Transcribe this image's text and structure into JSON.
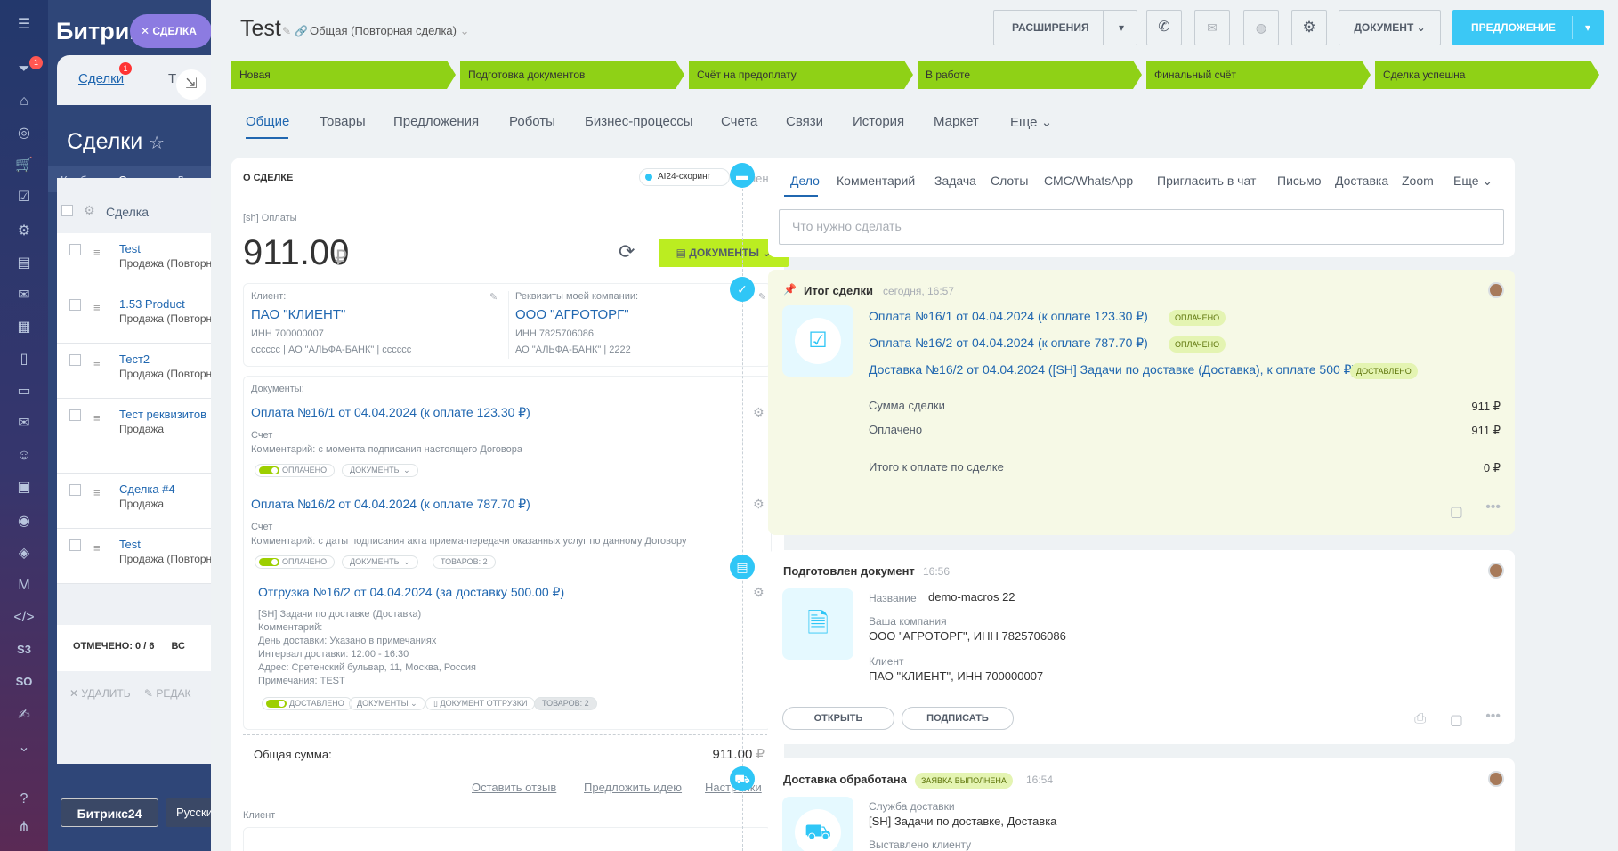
{
  "background": {
    "logo": "Битрикс",
    "deal_chip": "СДЕЛКА",
    "tab_deals": "Сделки",
    "tab_deals_badge": "1",
    "tab_second": "Т",
    "title": "Сделки",
    "view_kanban": "Канбан",
    "view_list": "Список",
    "view_more": "Де",
    "column_deal": "Сделка",
    "rows": [
      {
        "title": "Test",
        "subtitle": "Продажа (Повторн"
      },
      {
        "title": "1.53 Product",
        "subtitle": "Продажа (Повторн"
      },
      {
        "title": "Тест2",
        "subtitle": "Продажа (Повторн"
      },
      {
        "title": "Тест реквизитов",
        "subtitle": "Продажа"
      },
      {
        "title": "Сделка #4",
        "subtitle": "Продажа"
      },
      {
        "title": "Test",
        "subtitle": "Продажа (Повторн"
      }
    ],
    "marked": "ОТМЕЧЕНО: 0 / 6",
    "marked_suffix": "ВС",
    "delete": "УДАЛИТЬ",
    "edit": "РЕДАК",
    "bitrix24_btn": "Битрикс24",
    "lang_btn": "Русски",
    "rail_badge": "1",
    "rail_labels": [
      "S3",
      "SO"
    ]
  },
  "header": {
    "title": "Test",
    "category": "Общая (Повторная сделка)",
    "btn_extensions": "РАСШИРЕНИЯ",
    "btn_document": "ДОКУМЕНТ",
    "btn_offer": "ПРЕДЛОЖЕНИЕ"
  },
  "stages": [
    "Новая",
    "Подготовка документов",
    "Счёт на предоплату",
    "В работе",
    "Финальный счёт",
    "Сделка успешна"
  ],
  "stage_color": "#8fd116",
  "tabs": [
    "Общие",
    "Товары",
    "Предложения",
    "Роботы",
    "Бизнес-процессы",
    "Счета",
    "Связи",
    "История",
    "Маркет",
    "Еще"
  ],
  "about": {
    "title": "О СДЕЛКЕ",
    "ai_chip": "AI24-скоринг",
    "edit": "изменить",
    "payments_label": "[sh] Оплаты",
    "sum": "911.00",
    "currency": "₽",
    "docs_btn": "ДОКУМЕНТЫ",
    "client_label": "Клиент:",
    "client_name": "ПАО \"КЛИЕНТ\"",
    "client_inn": "ИНН 700000007",
    "client_bank": "сссссс | АО \"АЛЬФА-БАНК\" | сссссс",
    "company_label": "Реквизиты моей компании:",
    "company_name": "ООО \"АГРОТОРГ\"",
    "company_inn": "ИНН 7825706086",
    "company_bank": "АО \"АЛЬФА-БАНК\" | 2222",
    "documents_label": "Документы:",
    "doc1_title": "Оплата №16/1 от 04.04.2024 (к оплате 123.30 ₽)",
    "doc1_type": "Счет",
    "doc1_comment": "Комментарий: с момента подписания настоящего Договора",
    "doc2_title": "Оплата №16/2 от 04.04.2024 (к оплате 787.70 ₽)",
    "doc2_type": "Счет",
    "doc2_comment": "Комментарий: с даты подписания акта приема-передачи оказанных услуг по данному Договору",
    "paid": "ОПЛАЧЕНО",
    "documents_badge": "ДОКУМЕНТЫ",
    "goods2": "ТОВАРОВ: 2",
    "ship_title": "Отгрузка №16/2 от 04.04.2024 (за доставку 500.00 ₽)",
    "ship_service": "[SH] Задачи по доставке (Доставка)",
    "ship_comment": "Комментарий:",
    "ship_day": "День доставки: Указано в примечаниях",
    "ship_interval": "Интервал доставки: 12:00 - 16:30",
    "ship_address": "Адрес: Сретенский бульвар, 11, Москва, Россия",
    "ship_notes": "Примечания: TEST",
    "delivered": "ДОСТАВЛЕНО",
    "ship_doc": "ДОКУМЕНТ ОТГРУЗКИ",
    "total_label": "Общая сумма:",
    "total_value": "911.00",
    "link_review": "Оставить отзыв",
    "link_idea": "Предложить идею",
    "link_settings": "Настройки",
    "client_section": "Клиент"
  },
  "editor": {
    "tabs": [
      "Дело",
      "Комментарий",
      "Задача",
      "Слоты",
      "СМС/WhatsApp",
      "Пригласить в чат",
      "Письмо",
      "Доставка",
      "Zoom",
      "Еще"
    ],
    "placeholder": "Что нужно сделать"
  },
  "summary": {
    "title": "Итог сделки",
    "time": "сегодня, 16:57",
    "pay1": "Оплата №16/1 от 04.04.2024 (к оплате 123.30 ₽)",
    "pay2": "Оплата №16/2 от 04.04.2024 (к оплате 787.70 ₽)",
    "delivery": "Доставка №16/2 от 04.04.2024 ([SH] Задачи по доставке (Доставка), к оплате 500 ₽)",
    "badge_paid": "ОПЛАЧЕНО",
    "badge_delivered": "ДОСТАВЛЕНО",
    "deal_sum_label": "Сумма сделки",
    "deal_sum": "911 ₽",
    "paid_label": "Оплачено",
    "paid": "911 ₽",
    "due_label": "Итого к оплате по сделке",
    "due": "0 ₽"
  },
  "doc_card": {
    "title": "Подготовлен документ",
    "time": "16:56",
    "name_label": "Название",
    "name": "demo-macros 22",
    "company_label": "Ваша компания",
    "company": "ООО \"АГРОТОРГ\", ИНН 7825706086",
    "client_label": "Клиент",
    "client": "ПАО \"КЛИЕНТ\", ИНН 700000007",
    "open": "ОТКРЫТЬ",
    "sign": "ПОДПИСАТЬ"
  },
  "delivery_card": {
    "title": "Доставка обработана",
    "badge": "ЗАЯВКА ВЫПОЛНЕНА",
    "time": "16:54",
    "service_label": "Служба доставки",
    "service": "[SH] Задачи по доставке, Доставка",
    "issued_label": "Выставлено клиенту"
  }
}
